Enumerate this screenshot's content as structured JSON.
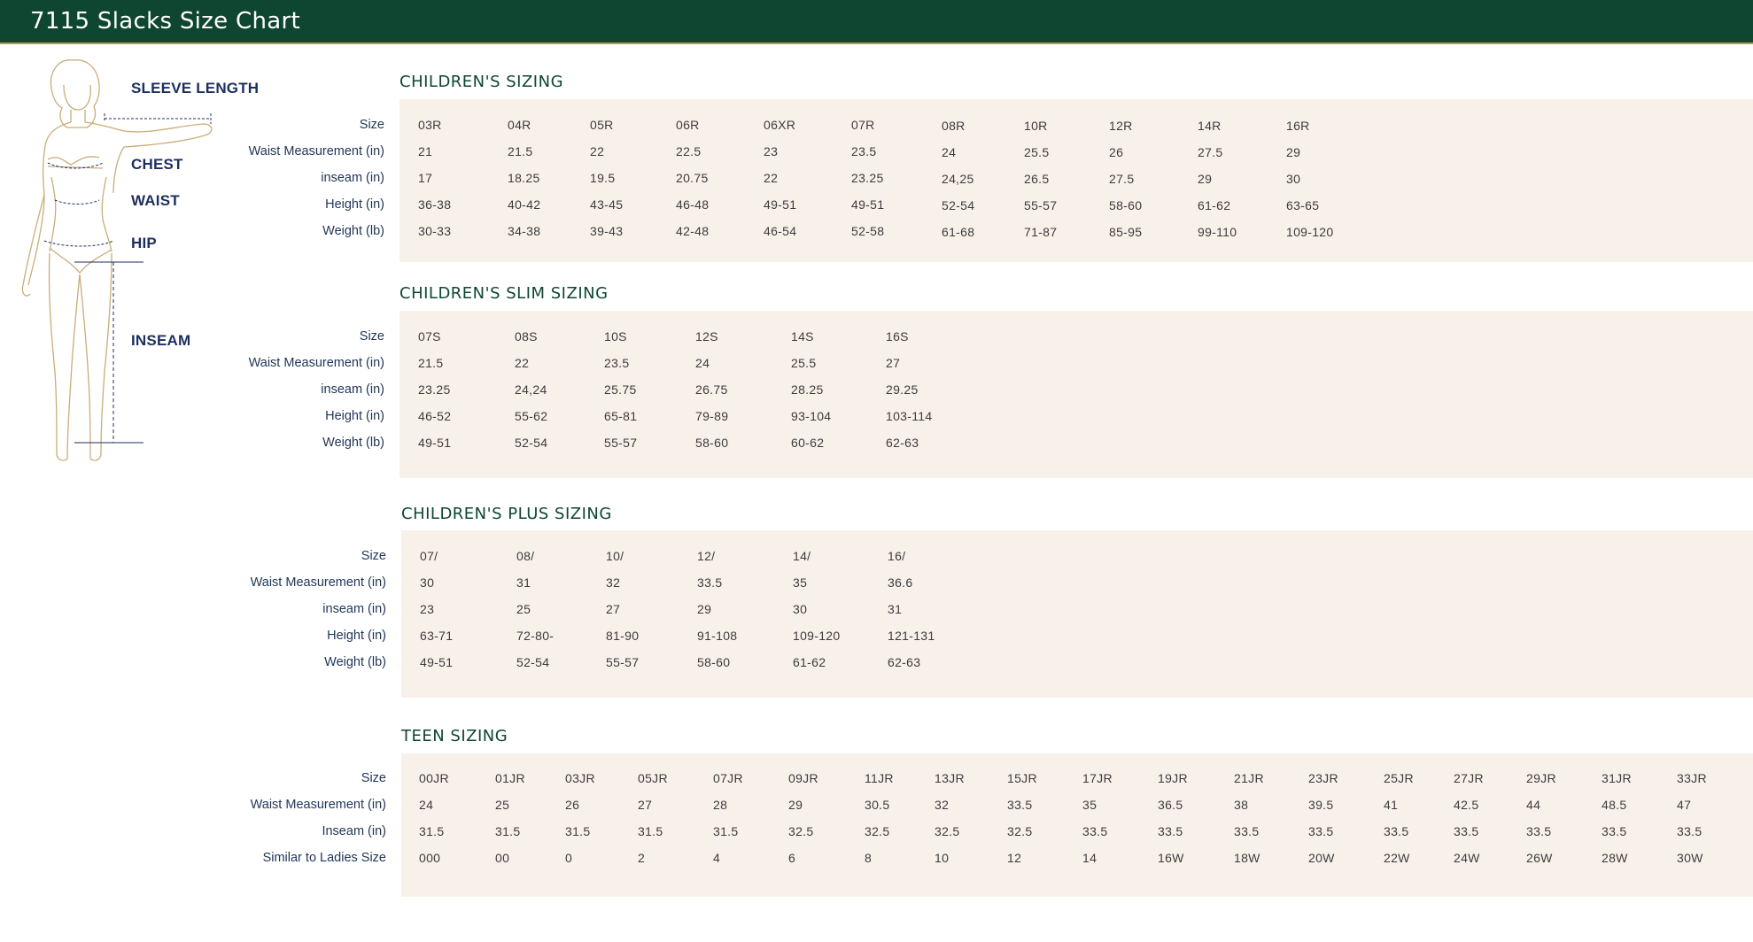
{
  "header": {
    "title": "7115 Slacks Size Chart"
  },
  "figure": {
    "labels": [
      "SLEEVE LENGTH",
      "CHEST",
      "WAIST",
      "HIP",
      "INSEAM"
    ]
  },
  "tables": [
    {
      "title": "CHILDREN'S SIZING",
      "rows": [
        {
          "label": "Size",
          "cells": [
            "03R",
            "04R",
            "05R",
            "06R",
            "06XR",
            "07R",
            "08R",
            "10R",
            "12R",
            "14R",
            "16R"
          ]
        },
        {
          "label": "Waist Measurement (in)",
          "cells": [
            "21",
            "21.5",
            "22",
            "22.5",
            "23",
            "23.5",
            "24",
            "25.5",
            "26",
            "27.5",
            "29"
          ]
        },
        {
          "label": "inseam (in)",
          "cells": [
            "17",
            "18.25",
            "19.5",
            "20.75",
            "22",
            "23.25",
            "24,25",
            "26.5",
            "27.5",
            "29",
            "30"
          ]
        },
        {
          "label": "Height (in)",
          "cells": [
            "36-38",
            "40-42",
            "43-45",
            "46-48",
            "49-51",
            "49-51",
            "52-54",
            "55-57",
            "58-60",
            "61-62",
            "63-65"
          ]
        },
        {
          "label": "Weight (lb)",
          "cells": [
            "30-33",
            "34-38",
            "39-43",
            "42-48",
            "46-54",
            "52-58",
            "61-68",
            "71-87",
            "85-95",
            "99-110",
            "109-120"
          ]
        }
      ]
    },
    {
      "title": "CHILDREN'S SLIM SIZING",
      "rows": [
        {
          "label": "Size",
          "cells": [
            "07S",
            "08S",
            "10S",
            "12S",
            "14S",
            "16S"
          ]
        },
        {
          "label": "Waist Measurement (in)",
          "cells": [
            "21.5",
            "22",
            "23.5",
            "24",
            "25.5",
            "27"
          ]
        },
        {
          "label": "inseam (in)",
          "cells": [
            "23.25",
            "24,24",
            "25.75",
            "26.75",
            "28.25",
            "29.25"
          ]
        },
        {
          "label": "Height (in)",
          "cells": [
            "46-52",
            "55-62",
            "65-81",
            "79-89",
            "93-104",
            "103-114"
          ]
        },
        {
          "label": "Weight (lb)",
          "cells": [
            "49-51",
            "52-54",
            "55-57",
            "58-60",
            "60-62",
            "62-63"
          ]
        }
      ]
    },
    {
      "title": "CHILDREN'S PLUS SIZING",
      "rows": [
        {
          "label": "Size",
          "cells": [
            "07/",
            "08/",
            "10/",
            "12/",
            "14/",
            "16/"
          ]
        },
        {
          "label": "Waist Measurement (in)",
          "cells": [
            "30",
            "31",
            "32",
            "33.5",
            "35",
            "36.6"
          ]
        },
        {
          "label": "inseam (in)",
          "cells": [
            "23",
            "25",
            "27",
            "29",
            "30",
            "31"
          ]
        },
        {
          "label": "Height (in)",
          "cells": [
            "63-71",
            "72-80-",
            "81-90",
            "91-108",
            "109-120",
            "121-131"
          ]
        },
        {
          "label": "Weight (lb)",
          "cells": [
            "49-51",
            "52-54",
            "55-57",
            "58-60",
            "61-62",
            "62-63"
          ]
        }
      ]
    },
    {
      "title": "TEEN SIZING",
      "rows": [
        {
          "label": "Size",
          "cells": [
            "00JR",
            "01JR",
            "03JR",
            "05JR",
            "07JR",
            "09JR",
            "11JR",
            "13JR",
            "15JR",
            "17JR",
            "19JR",
            "21JR",
            "23JR",
            "25JR",
            "27JR",
            "29JR",
            "31JR",
            "33JR"
          ]
        },
        {
          "label": "Waist Measurement (in)",
          "cells": [
            "24",
            "25",
            "26",
            "27",
            "28",
            "29",
            "30.5",
            "32",
            "33.5",
            "35",
            "36.5",
            "38",
            "39.5",
            "41",
            "42.5",
            "44",
            "48.5",
            "47"
          ]
        },
        {
          "label": "Inseam (in)",
          "cells": [
            "31.5",
            "31.5",
            "31.5",
            "31.5",
            "31.5",
            "32.5",
            "32.5",
            "32.5",
            "32.5",
            "33.5",
            "33.5",
            "33.5",
            "33.5",
            "33.5",
            "33.5",
            "33.5",
            "33.5",
            "33.5"
          ]
        },
        {
          "label": "Similar to Ladies Size",
          "cells": [
            "000",
            "00",
            "0",
            "2",
            "4",
            "6",
            "8",
            "10",
            "12",
            "14",
            "16W",
            "18W",
            "20W",
            "22W",
            "24W",
            "26W",
            "28W",
            "30W"
          ]
        }
      ]
    }
  ]
}
